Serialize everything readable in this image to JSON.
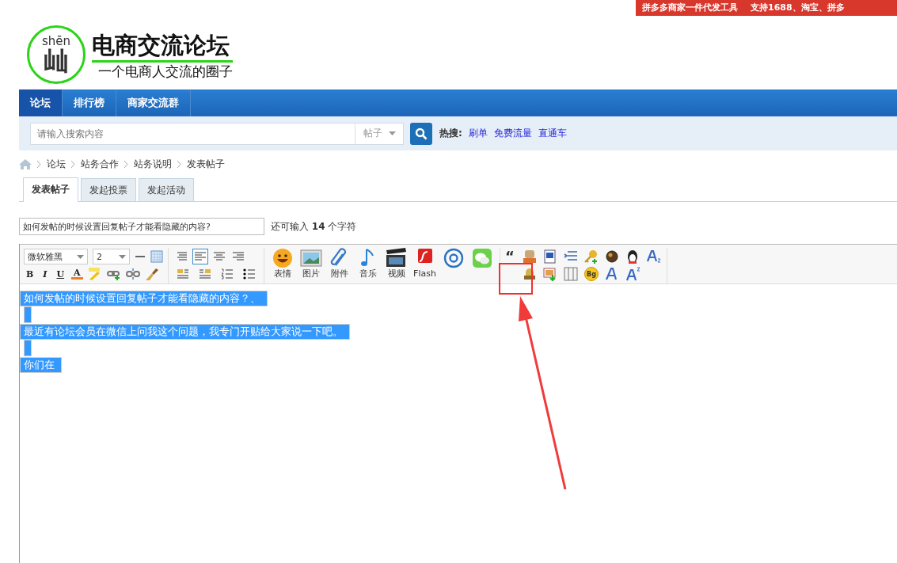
{
  "promo_banner": {
    "items": [
      "拼多多商家一件代发工具",
      "支持1688、淘宝、拼多"
    ]
  },
  "logo": {
    "pinyin": "shēn",
    "glyph": "屾",
    "title": "电商交流论坛",
    "slogan": "一个电商人交流的圈子"
  },
  "nav": {
    "items": [
      {
        "label": "论坛",
        "selected": true
      },
      {
        "label": "排行榜",
        "selected": false
      },
      {
        "label": "商家交流群",
        "selected": false
      }
    ]
  },
  "search": {
    "placeholder": "请输入搜索内容",
    "scope": "帖子",
    "hot_label": "热搜:",
    "hot_links": [
      "刷单",
      "免费流量",
      "直通车"
    ]
  },
  "breadcrumb": [
    "论坛",
    "站务合作",
    "站务说明",
    "发表帖子"
  ],
  "tabs": [
    {
      "label": "发表帖子",
      "selected": true
    },
    {
      "label": "发起投票",
      "selected": false
    },
    {
      "label": "发起活动",
      "selected": false
    }
  ],
  "subject": {
    "value": "如何发帖的时候设置回复帖子才能看隐藏的内容?",
    "hint_before": "还可输入",
    "count": "14",
    "hint_after": "个字符"
  },
  "toolbar": {
    "font": "微软雅黑",
    "size": "2",
    "format_buttons": [
      "B",
      "I",
      "U",
      "A"
    ],
    "align_buttons": [
      {
        "selected": false
      },
      {
        "selected": true
      },
      {
        "selected": false
      },
      {
        "selected": false
      }
    ],
    "media_buttons": [
      {
        "kind": "emoji",
        "label": "表情"
      },
      {
        "kind": "image",
        "label": "图片"
      },
      {
        "kind": "attachment",
        "label": "附件"
      },
      {
        "kind": "music",
        "label": "音乐"
      },
      {
        "kind": "video",
        "label": "视频"
      },
      {
        "kind": "flash",
        "label": "Flash"
      },
      {
        "kind": "at"
      },
      {
        "kind": "wechat"
      }
    ],
    "quote_mark": "“",
    "bg_button": "Bg"
  },
  "editor": {
    "lines": [
      {
        "kind": "text",
        "text": "如何发帖的时候设置回复帖子才能看隐藏的内容？、",
        "selected": true
      },
      {
        "kind": "blank",
        "selected": true
      },
      {
        "kind": "text",
        "text": "最近有论坛会员在微信上问我这个问题，我专门开贴给大家说一下吧。",
        "selected": true
      },
      {
        "kind": "blank",
        "selected": true
      },
      {
        "kind": "text",
        "text": "你们在",
        "selected": true
      }
    ]
  }
}
